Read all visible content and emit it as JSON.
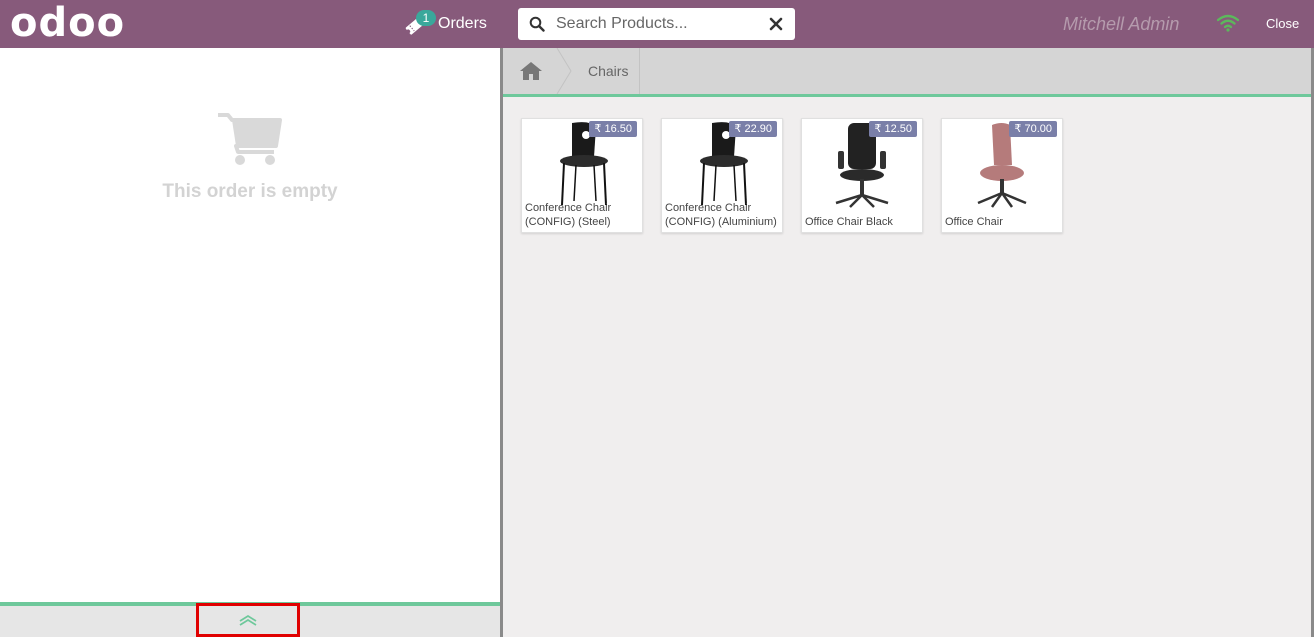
{
  "header": {
    "logo_text": "odoo",
    "orders_label": "Orders",
    "orders_count": "1",
    "search_placeholder": "Search Products...",
    "user_name": "Mitchell Admin",
    "close_label": "Close"
  },
  "order": {
    "empty_message": "This order is empty"
  },
  "breadcrumbs": {
    "category": "Chairs"
  },
  "products": [
    {
      "name": "Conference Chair (CONFIG) (Steel)",
      "price": "₹ 16.50"
    },
    {
      "name": "Conference Chair (CONFIG) (Aluminium)",
      "price": "₹ 22.90"
    },
    {
      "name": "Office Chair Black",
      "price": "₹ 12.50"
    },
    {
      "name": "Office Chair",
      "price": "₹ 70.00"
    }
  ],
  "colors": {
    "header_bg": "#875a7b",
    "accent_green": "#6ec89b",
    "badge": "#3aa89b",
    "price_tag": "#7a7fa8",
    "highlight_box": "#e00000"
  }
}
